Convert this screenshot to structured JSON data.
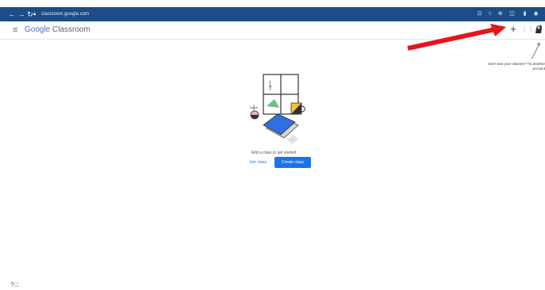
{
  "browser": {
    "back_icon": "back-arrow-icon",
    "forward_icon": "forward-arrow-icon",
    "reload_icon": "reload-icon",
    "url": "classroom.google.com",
    "extension_icons": [
      "install-icon",
      "star-icon",
      "extension-icon",
      "puzzle-icon",
      "sidebar-icon",
      "profile-icon"
    ]
  },
  "appbar": {
    "menu_icon": "hamburger-menu-icon",
    "brand_google": "Google",
    "brand_product": " Classroom",
    "add_icon": "plus-icon",
    "apps_icon": "apps-grid-icon"
  },
  "tooltip": {
    "text": "Don't see your classes? Try another account"
  },
  "empty_state": {
    "message": "Add a class to get started",
    "join_label": "Join class",
    "create_label": "Create class"
  },
  "help_icon": "help-icon",
  "colors": {
    "chrome_bar": "#1d4c86",
    "primary": "#1a73e8",
    "annotation_arrow": "#e8131a"
  }
}
